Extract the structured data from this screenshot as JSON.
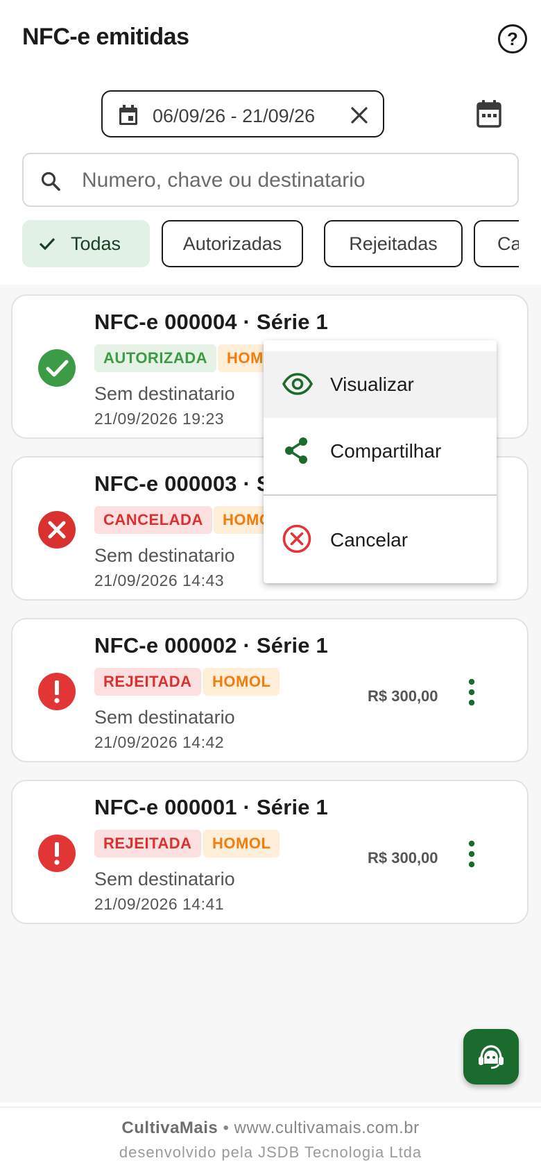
{
  "header": {
    "title": "NFC-e emitidas",
    "help_icon": "help-circle-icon"
  },
  "date_filter": {
    "range": "06/09/26 - 21/09/26",
    "calendar_icon": "calendar-event-icon",
    "clear_icon": "close-icon",
    "picker_icon": "calendar-month-icon"
  },
  "search": {
    "placeholder": "Numero, chave ou destinatario",
    "value": "",
    "icon": "search-icon"
  },
  "filters": {
    "chips": [
      {
        "label": "Todas",
        "selected": true
      },
      {
        "label": "Autorizadas",
        "selected": false
      },
      {
        "label": "Rejeitadas",
        "selected": false
      },
      {
        "label": "Canceladas",
        "selected": false
      }
    ]
  },
  "invoices": [
    {
      "title": "NFC-e 000004 · Série 1",
      "status": "AUTORIZADA",
      "env": "HOMOL",
      "recipient": "Sem destinatario",
      "datetime": "21/09/2026 19:23",
      "amount": "",
      "status_icon": "check-circle-icon",
      "status_color": "#3d9a46"
    },
    {
      "title": "NFC-e 000003 · Série 1",
      "status": "CANCELADA",
      "env": "HOMOL",
      "recipient": "Sem destinatario",
      "datetime": "21/09/2026 14:43",
      "amount": "",
      "status_icon": "x-circle-icon",
      "status_color": "#d93030"
    },
    {
      "title": "NFC-e 000002 · Série 1",
      "status": "REJEITADA",
      "env": "HOMOL",
      "recipient": "Sem destinatario",
      "datetime": "21/09/2026 14:42",
      "amount": "R$ 300,00",
      "status_icon": "alert-circle-icon",
      "status_color": "#e23636"
    },
    {
      "title": "NFC-e 000001 · Série 1",
      "status": "REJEITADA",
      "env": "HOMOL",
      "recipient": "Sem destinatario",
      "datetime": "21/09/2026 14:41",
      "amount": "R$ 300,00",
      "status_icon": "alert-circle-icon",
      "status_color": "#e23636"
    }
  ],
  "context_menu": {
    "items": [
      {
        "label": "Visualizar",
        "icon": "eye-icon"
      },
      {
        "label": "Compartilhar",
        "icon": "share-icon"
      },
      {
        "label": "Cancelar",
        "icon": "cancel-circle-icon"
      }
    ]
  },
  "fab": {
    "icon": "support-agent-icon"
  },
  "footer": {
    "brand": "CultivaMais",
    "separator": "•",
    "site": "www.cultivamais.com.br",
    "credit": "desenvolvido pela JSDB Tecnologia Ltda"
  },
  "colors": {
    "primary": "#1b6b2f",
    "success": "#3d9a46",
    "danger": "#d93030",
    "warning": "#f07d0e",
    "chip_selected_bg": "#e2f1e5"
  }
}
